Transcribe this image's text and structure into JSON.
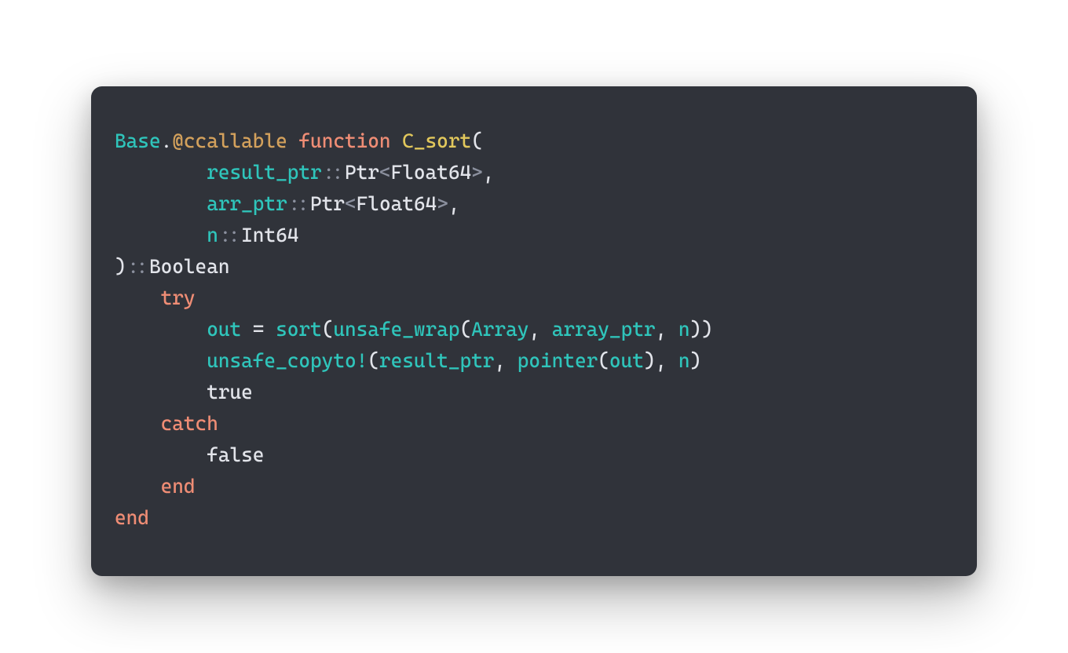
{
  "code": {
    "line1": {
      "module": "Base",
      "dot": ".",
      "macro": "@ccallable",
      "space": " ",
      "kw_function": "function",
      "space2": " ",
      "fn_name": "C_sort",
      "open": "("
    },
    "line2": {
      "indent": "        ",
      "var": "result_ptr",
      "colon": "::",
      "type1": "Ptr",
      "lt": "<",
      "type2": "Float64",
      "gt": ">",
      "comma": ","
    },
    "line3": {
      "indent": "        ",
      "var": "arr_ptr",
      "colon": "::",
      "type1": "Ptr",
      "lt": "<",
      "type2": "Float64",
      "gt": ">",
      "comma": ","
    },
    "line4": {
      "indent": "        ",
      "var": "n",
      "colon": "::",
      "type": "Int64"
    },
    "line5": {
      "close": ")",
      "colon": "::",
      "type": "Boolean"
    },
    "line6": {
      "indent": "    ",
      "kw": "try"
    },
    "line7": {
      "indent": "        ",
      "var_out": "out",
      "eq": " = ",
      "fn_sort": "sort",
      "open1": "(",
      "fn_wrap": "unsafe_wrap",
      "open2": "(",
      "arg1": "Array",
      "c1": ", ",
      "arg2": "array_ptr",
      "c2": ", ",
      "arg3": "n",
      "close": "))"
    },
    "line8": {
      "indent": "        ",
      "fn": "unsafe_copyto!",
      "open": "(",
      "arg1": "result_ptr",
      "c1": ", ",
      "fn_ptr": "pointer",
      "open2": "(",
      "arg2": "out",
      "close2": ")",
      "c2": ", ",
      "arg3": "n",
      "close": ")"
    },
    "line9": {
      "indent": "        ",
      "val": "true"
    },
    "line10": {
      "indent": "    ",
      "kw": "catch"
    },
    "line11": {
      "indent": "        ",
      "val": "false"
    },
    "line12": {
      "indent": "    ",
      "kw": "end"
    },
    "line13": {
      "kw": "end"
    }
  },
  "colors": {
    "panel_bg": "#30333a",
    "page_bg": "#ffffff",
    "teal": "#2fc5bb",
    "orange_macro": "#d3a15c",
    "salmon": "#ef8d75",
    "yellow": "#e2c85c",
    "text": "#e2e4ea",
    "dim": "#8b909e"
  }
}
